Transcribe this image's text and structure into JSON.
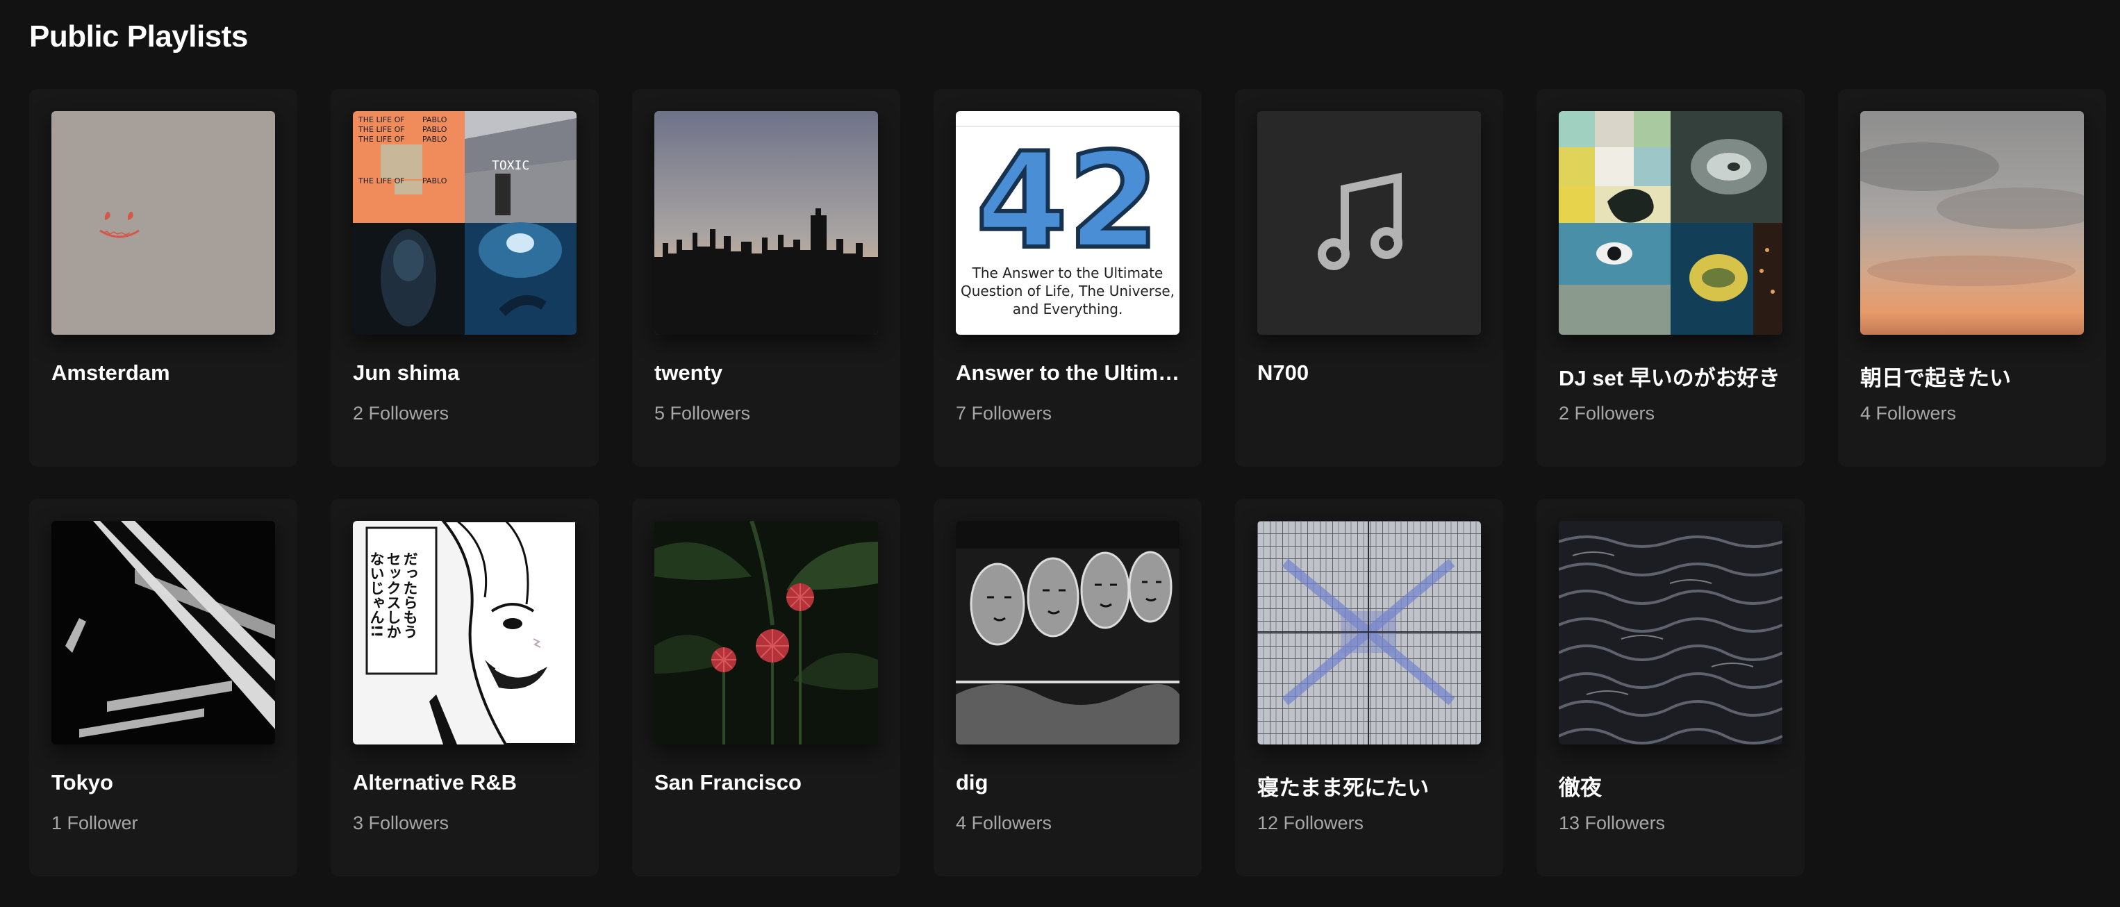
{
  "section": {
    "title": "Public Playlists"
  },
  "playlists": [
    {
      "title": "Amsterdam",
      "followers": "",
      "cover": "smiley-art"
    },
    {
      "title": "Jun shima",
      "followers": "2 Followers",
      "cover": "collage-album-art",
      "cover_text": {
        "album": "THE LIFE OF",
        "artist": "PABLO",
        "toxic": "TOXIC"
      }
    },
    {
      "title": "twenty",
      "followers": "5 Followers",
      "cover": "city-skyline-photo"
    },
    {
      "title": "Answer to the Ultimate Question of Life, The Universe, and Everything",
      "followers": "7 Followers",
      "cover": "42-art",
      "cover_text": {
        "number": "42",
        "line1": "The Answer to the Ultimate",
        "line2": "Question of Life, The Universe,",
        "line3": "and Everything."
      }
    },
    {
      "title": "N700",
      "followers": "",
      "cover": "music-note-icon"
    },
    {
      "title": "DJ set 早いのがお好き",
      "followers": "2 Followers",
      "cover": "collage-art"
    },
    {
      "title": "朝日で起きたい",
      "followers": "4 Followers",
      "cover": "sunrise-sky-photo"
    },
    {
      "title": "Tokyo",
      "followers": "1 Follower",
      "cover": "typography-art"
    },
    {
      "title": "Alternative R&B",
      "followers": "3 Followers",
      "cover": "manga-art",
      "cover_text": {
        "line1": "だったらもう",
        "line2": "セックスしか",
        "line3": "ないじゃん!!"
      }
    },
    {
      "title": "San Francisco",
      "followers": "",
      "cover": "red-flowers-photo"
    },
    {
      "title": "dig",
      "followers": "4 Followers",
      "cover": "sketch-faces-art"
    },
    {
      "title": "寝たまま死にたい",
      "followers": "12 Followers",
      "cover": "grid-pattern-art"
    },
    {
      "title": "徹夜",
      "followers": "13 Followers",
      "cover": "dark-water-photo"
    }
  ],
  "colors": {
    "background": "#121212",
    "card": "#181818",
    "title": "#ffffff",
    "subtitle": "#a7a7a7"
  }
}
